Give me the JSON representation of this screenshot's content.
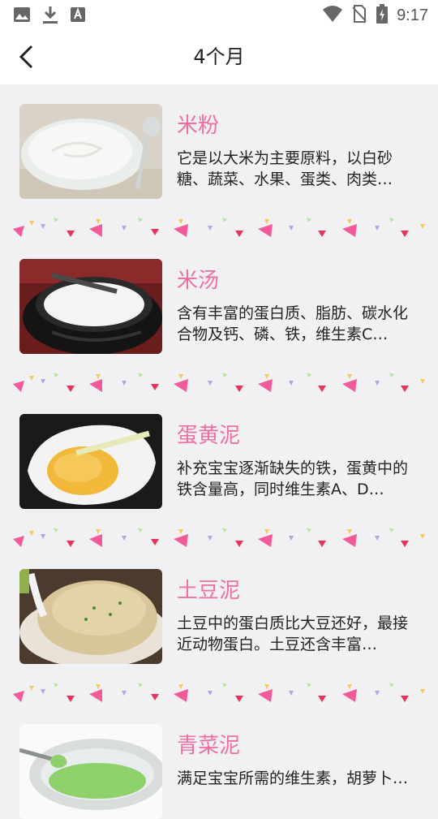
{
  "statusbar": {
    "time": "9:17",
    "left_icons": [
      "image-icon",
      "download-icon",
      "font-icon"
    ],
    "right_icons": [
      "wifi-icon",
      "no-sim-icon",
      "battery-charging-icon"
    ]
  },
  "header": {
    "title": "4个月"
  },
  "foods": [
    {
      "name": "米粉",
      "desc": "它是以大米为主要原料，以白砂糖、蔬菜、水果、蛋类、肉类…"
    },
    {
      "name": "米汤",
      "desc": "含有丰富的蛋白质、脂肪、碳水化合物及钙、磷、铁，维生素C…"
    },
    {
      "name": "蛋黄泥",
      "desc": "补充宝宝逐渐缺失的铁，蛋黄中的铁含量高，同时维生素A、D…"
    },
    {
      "name": "土豆泥",
      "desc": "土豆中的蛋白质比大豆还好，最接近动物蛋白。土豆还含丰富…"
    },
    {
      "name": "青菜泥",
      "desc": "满足宝宝所需的维生素，胡萝卜…"
    }
  ],
  "colors": {
    "title_pink": "#ef6f9e",
    "confetti": [
      "#f25a9a",
      "#e8325c",
      "#f7c95c",
      "#b9a3e6",
      "#b7e6a0"
    ]
  }
}
